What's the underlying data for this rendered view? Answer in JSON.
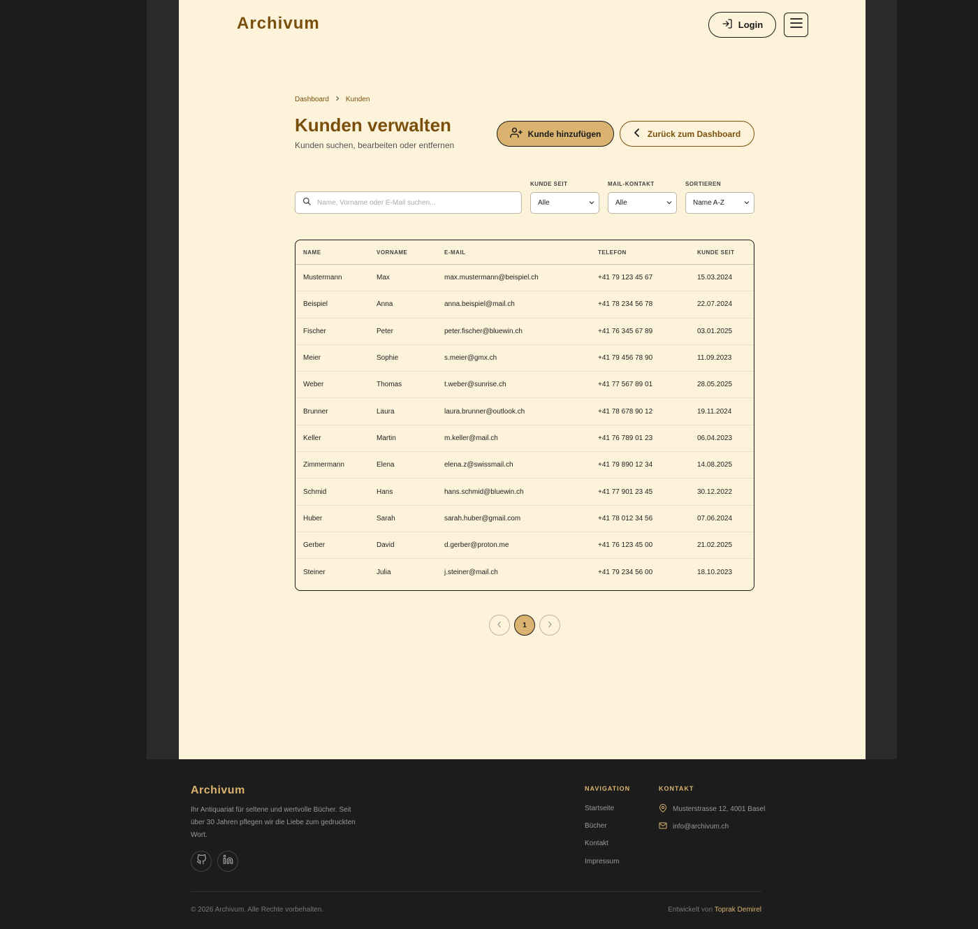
{
  "header": {
    "logo": "Archivum",
    "login_label": "Login"
  },
  "breadcrumb": {
    "items": [
      "Dashboard",
      "Kunden"
    ]
  },
  "page": {
    "title": "Kunden verwalten",
    "subtitle": "Kunden suchen, bearbeiten oder entfernen",
    "add_button": "Kunde hinzufügen",
    "back_button": "Zurück zum Dashboard"
  },
  "search": {
    "placeholder": "Name, Vorname oder E-Mail suchen..."
  },
  "filters": {
    "since_label": "KUNDE SEIT",
    "since_value": "Alle",
    "mail_label": "MAIL-KONTAKT",
    "mail_value": "Alle",
    "sort_label": "SORTIEREN",
    "sort_value": "Name A-Z"
  },
  "table": {
    "headers": [
      "NAME",
      "VORNAME",
      "E-MAIL",
      "TELEFON",
      "KUNDE SEIT"
    ],
    "rows": [
      [
        "Mustermann",
        "Max",
        "max.mustermann@beispiel.ch",
        "+41 79 123 45 67",
        "15.03.2024"
      ],
      [
        "Beispiel",
        "Anna",
        "anna.beispiel@mail.ch",
        "+41 78 234 56 78",
        "22.07.2024"
      ],
      [
        "Fischer",
        "Peter",
        "peter.fischer@bluewin.ch",
        "+41 76 345 67 89",
        "03.01.2025"
      ],
      [
        "Meier",
        "Sophie",
        "s.meier@gmx.ch",
        "+41 79 456 78 90",
        "11.09.2023"
      ],
      [
        "Weber",
        "Thomas",
        "t.weber@sunrise.ch",
        "+41 77 567 89 01",
        "28.05.2025"
      ],
      [
        "Brunner",
        "Laura",
        "laura.brunner@outlook.ch",
        "+41 78 678 90 12",
        "19.11.2024"
      ],
      [
        "Keller",
        "Martin",
        "m.keller@mail.ch",
        "+41 76 789 01 23",
        "06.04.2023"
      ],
      [
        "Zimmermann",
        "Elena",
        "elena.z@swissmail.ch",
        "+41 79 890 12 34",
        "14.08.2025"
      ],
      [
        "Schmid",
        "Hans",
        "hans.schmid@bluewin.ch",
        "+41 77 901 23 45",
        "30.12.2022"
      ],
      [
        "Huber",
        "Sarah",
        "sarah.huber@gmail.com",
        "+41 78 012 34 56",
        "07.06.2024"
      ],
      [
        "Gerber",
        "David",
        "d.gerber@proton.me",
        "+41 76 123 45 00",
        "21.02.2025"
      ],
      [
        "Steiner",
        "Julia",
        "j.steiner@mail.ch",
        "+41 79 234 56 00",
        "18.10.2023"
      ]
    ]
  },
  "pagination": {
    "current": "1"
  },
  "footer": {
    "logo": "Archivum",
    "description": "Ihr Antiquariat für seltene und wertvolle Bücher. Seit über 30 Jahren pflegen wir die Liebe zum gedruckten Wort.",
    "nav_heading": "NAVIGATION",
    "nav_links": [
      "Startseite",
      "Bücher",
      "Kontakt",
      "Impressum"
    ],
    "contact_heading": "KONTAKT",
    "address": "Musterstrasse 12, 4001 Basel",
    "email": "info@archivum.ch",
    "copyright": "© 2026 Archivum. Alle Rechte vorbehalten.",
    "dev_prefix": "Entwickelt von",
    "dev_name": "Toprak Demirel"
  },
  "icons": {
    "login": "login-icon",
    "menu": "menu-icon",
    "add_user": "user-plus-icon",
    "back": "chevron-left-icon",
    "search": "search-icon",
    "github": "github-icon",
    "linkedin": "linkedin-icon",
    "location": "map-pin-icon",
    "mail": "mail-icon"
  },
  "colors": {
    "page_bg": "#fdf3da",
    "accent": "#7a4f0c",
    "gold": "#d9b36f",
    "dark": "#1c1c1c"
  }
}
